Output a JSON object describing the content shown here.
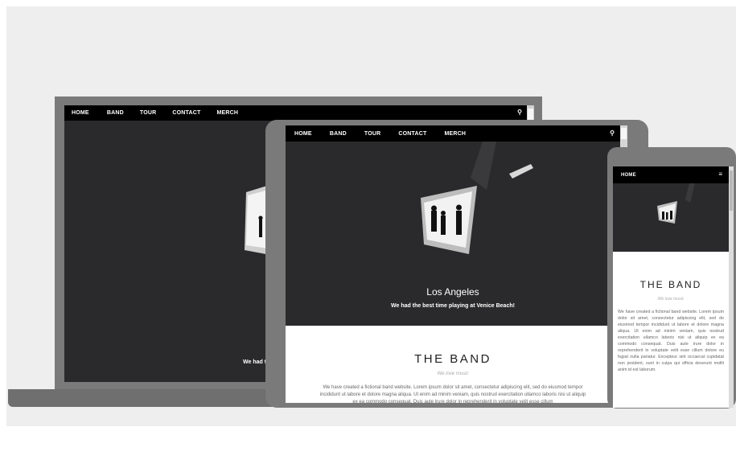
{
  "laptop": {
    "nav": {
      "items": [
        "HOME",
        "BAND",
        "TOUR",
        "CONTACT",
        "MERCH"
      ],
      "search_icon": "search-icon"
    },
    "caption": "We had th"
  },
  "tablet": {
    "nav": {
      "items": [
        "HOME",
        "BAND",
        "TOUR",
        "CONTACT",
        "MERCH"
      ],
      "search_icon": "search-icon"
    },
    "hero": {
      "title": "Los Angeles",
      "subtitle": "We had the best time playing at Venice Beach!"
    },
    "band": {
      "title": "THE BAND",
      "tagline": "We love music",
      "text": "We have created a fictional band website. Lorem ipsum dolor sit amet, consectetur adipiscing elit, sed do eiusmod tempor incididunt ut labore et dolore magna aliqua. Ut enim ad minim veniam, quis nostrud exercitation ullamco laboris nisi ut aliquip ex ea commodo consequat. Duis aute irure dolor in reprehenderit in voluptate velit esse cillum"
    }
  },
  "phone": {
    "nav": {
      "items": [
        "HOME"
      ],
      "menu_icon": "hamburger-menu-icon"
    },
    "band": {
      "title": "THE BAND",
      "tagline": "We love music",
      "text": "We have created a fictional band website. Lorem ipsum dolor sit amet, consectetur adipiscing elit, sed do eiusmod tempor incididunt ut labore et dolore magna aliqua. Ut enim ad minim veniam, quis nostrud exercitation ullamco laboris nisi ut aliquip ex ea commodo consequat. Duis aute irure dolor in reprehenderit in voluptate velit esse cillum dolore eu fugiat nulla pariatur. Excepteur sint occaecat cupidatat non proident, sunt in culpa qui officia deserunt mollit anim id est laborum."
    }
  },
  "colors": {
    "background": "#eeeeee",
    "device_frame": "#7a7a7a",
    "screen_dark": "#2a2a2c",
    "nav": "#000000",
    "text_light": "#ffffff"
  }
}
